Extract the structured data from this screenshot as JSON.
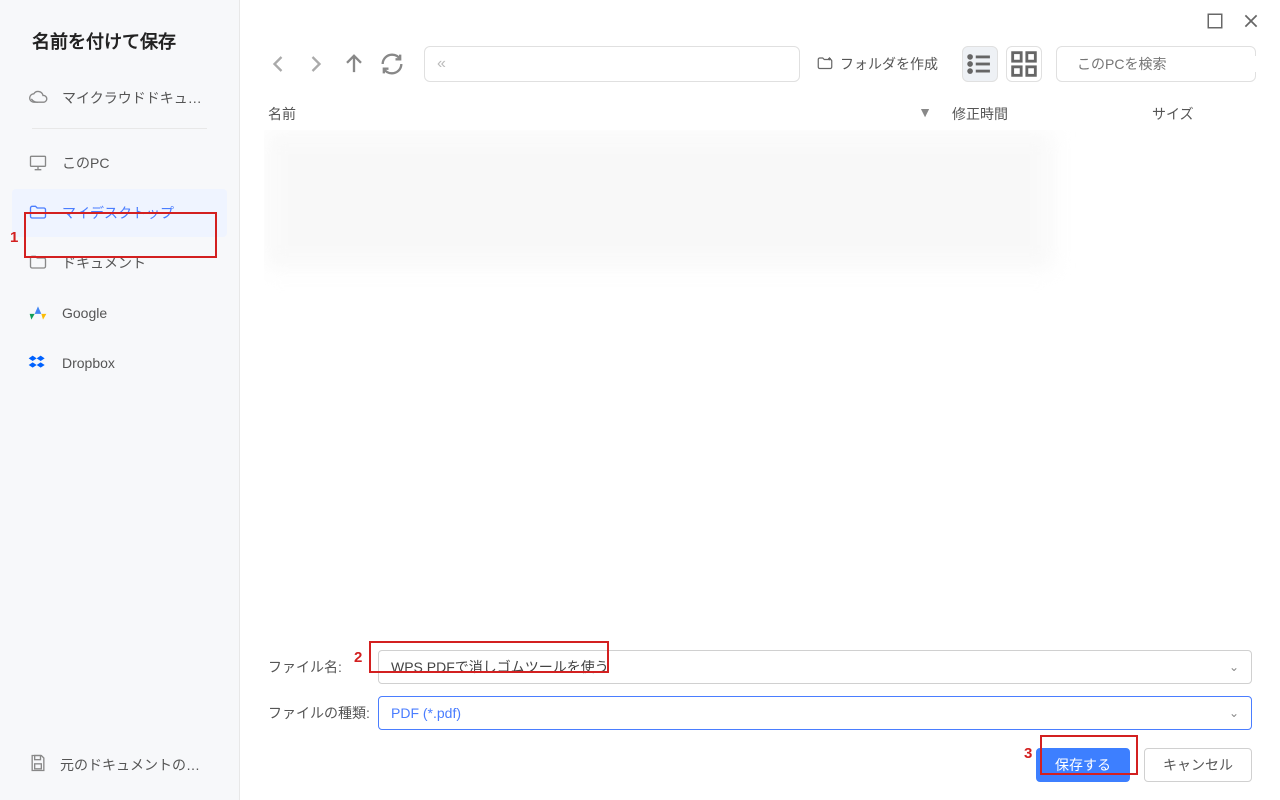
{
  "title": "名前を付けて保存",
  "sidebar": {
    "items": [
      {
        "label": "マイクラウドドキュ…",
        "icon": "cloud"
      },
      {
        "label": "このPC",
        "icon": "monitor"
      },
      {
        "label": "マイデスクトップ",
        "icon": "folder",
        "active": true
      },
      {
        "label": "ドキュメント",
        "icon": "folder"
      },
      {
        "label": "Google",
        "icon": "google"
      },
      {
        "label": "Dropbox",
        "icon": "dropbox"
      }
    ],
    "footer": "元のドキュメントの…"
  },
  "toolbar": {
    "path_placeholder": "«",
    "create_folder": "フォルダを作成",
    "search_placeholder": "このPCを検索"
  },
  "columns": {
    "name": "名前",
    "modified": "修正時間",
    "size": "サイズ"
  },
  "form": {
    "filename_label": "ファイル名:",
    "filename_value": "WPS PDFで消しゴムツールを使う",
    "filetype_label": "ファイルの種類:",
    "filetype_value": "PDF (*.pdf)",
    "save": "保存する",
    "cancel": "キャンセル"
  },
  "annotations": {
    "a1": "1",
    "a2": "2",
    "a3": "3"
  }
}
